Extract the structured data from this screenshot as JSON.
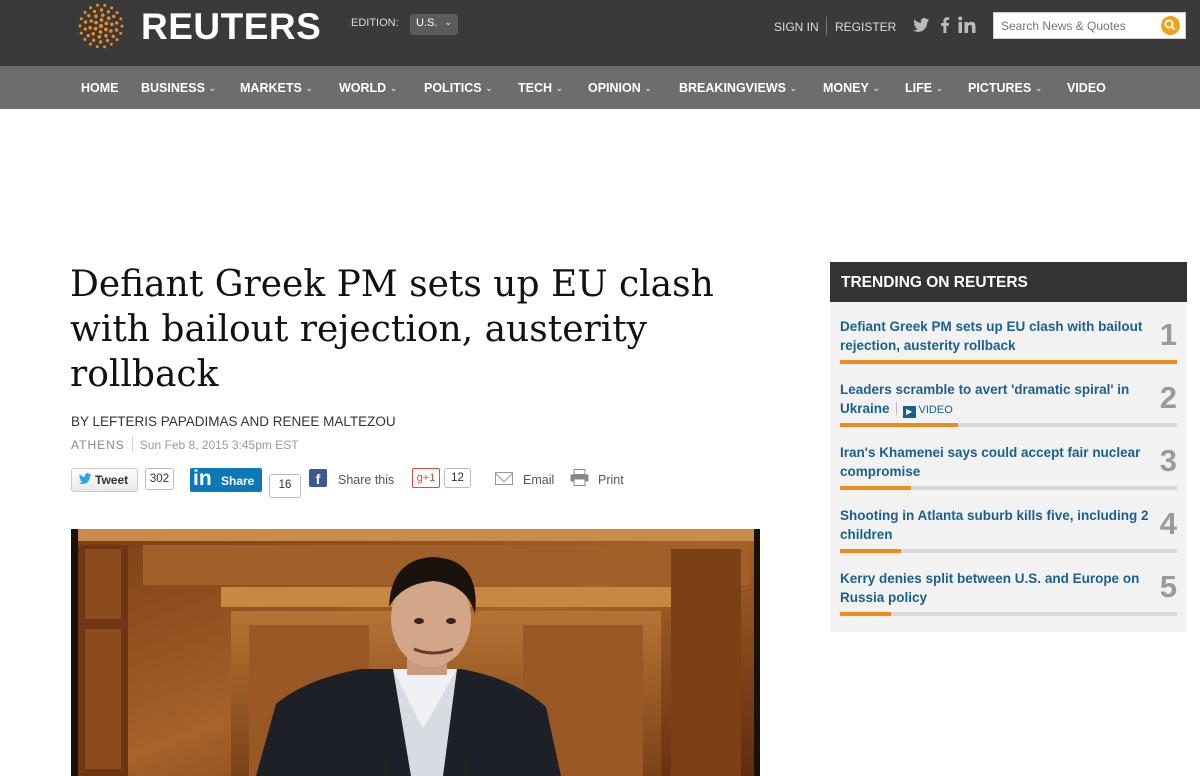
{
  "header": {
    "logo_text": "REUTERS",
    "edition_label": "EDITION:",
    "edition_value": "U.S.",
    "sign_in": "SIGN IN",
    "register": "REGISTER",
    "search_placeholder": "Search News & Quotes",
    "social_icons": [
      "twitter-icon",
      "facebook-icon",
      "linkedin-icon"
    ]
  },
  "nav": {
    "items": [
      {
        "label": "HOME",
        "has_menu": false
      },
      {
        "label": "BUSINESS",
        "has_menu": true
      },
      {
        "label": "MARKETS",
        "has_menu": true
      },
      {
        "label": "WORLD",
        "has_menu": true
      },
      {
        "label": "POLITICS",
        "has_menu": true
      },
      {
        "label": "TECH",
        "has_menu": true
      },
      {
        "label": "OPINION",
        "has_menu": true
      },
      {
        "label": "BREAKINGVIEWS",
        "has_menu": true
      },
      {
        "label": "MONEY",
        "has_menu": true
      },
      {
        "label": "LIFE",
        "has_menu": true
      },
      {
        "label": "PICTURES",
        "has_menu": true
      },
      {
        "label": "VIDEO",
        "has_menu": false
      }
    ]
  },
  "article": {
    "headline": "Defiant Greek PM sets up EU clash with bailout rejection, austerity rollback",
    "byline": "BY LEFTERIS PAPADIMAS AND RENEE MALTEZOU",
    "city": "ATHENS",
    "date": "Sun Feb 8, 2015 3:45pm EST",
    "share": {
      "tweet_label": "Tweet",
      "tweet_count": "302",
      "linkedin_label": "Share",
      "linkedin_count": "16",
      "facebook_label": "Share this",
      "gplus_label": "g+1",
      "gplus_count": "12",
      "email_label": "Email",
      "print_label": "Print"
    }
  },
  "trending": {
    "title": "TRENDING ON REUTERS",
    "accent_color": "#f08a1c",
    "items": [
      {
        "rank": "1",
        "title": "Defiant Greek PM sets up EU clash with bailout rejection, austerity rollback",
        "popularity": 1.0,
        "video": ""
      },
      {
        "rank": "2",
        "title": "Leaders scramble to avert 'dramatic spiral' in Ukraine",
        "popularity": 0.35,
        "video": "VIDEO"
      },
      {
        "rank": "3",
        "title": "Iran's Khamenei says could accept fair nuclear compromise",
        "popularity": 0.21,
        "video": ""
      },
      {
        "rank": "4",
        "title": "Shooting in Atlanta suburb kills five, including 2 children",
        "popularity": 0.18,
        "video": ""
      },
      {
        "rank": "5",
        "title": "Kerry denies split between U.S. and Europe on Russia policy",
        "popularity": 0.15,
        "video": ""
      }
    ]
  }
}
